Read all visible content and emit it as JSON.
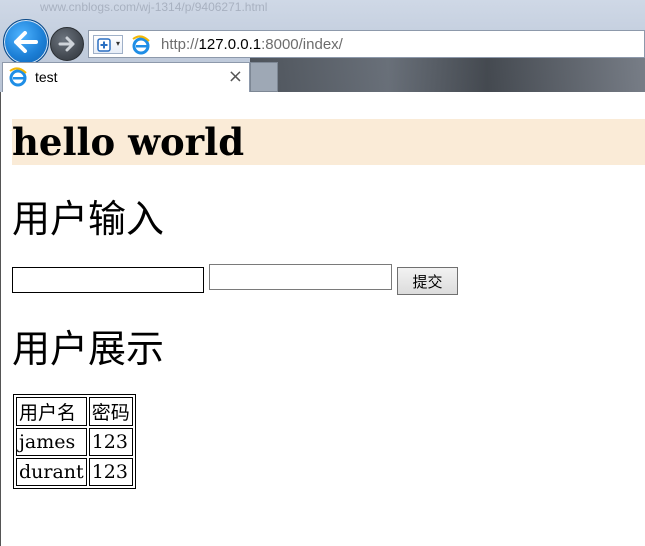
{
  "browser": {
    "ghost_url": "www.cnblogs.com/wj-1314/p/9406271.html",
    "address_host": "127.0.0.1",
    "address_port_path": ":8000/index/",
    "address_scheme": "http://",
    "tab_title": "test",
    "tab_close": "×"
  },
  "page": {
    "heading": "hello world",
    "input_section_title": "用户输入",
    "username_value": "",
    "password_value": "",
    "submit_label": "提交",
    "display_section_title": "用户展示",
    "table": {
      "headers": [
        "用户名",
        "密码"
      ],
      "rows": [
        [
          "james",
          "123"
        ],
        [
          "durant",
          "123"
        ]
      ]
    }
  }
}
